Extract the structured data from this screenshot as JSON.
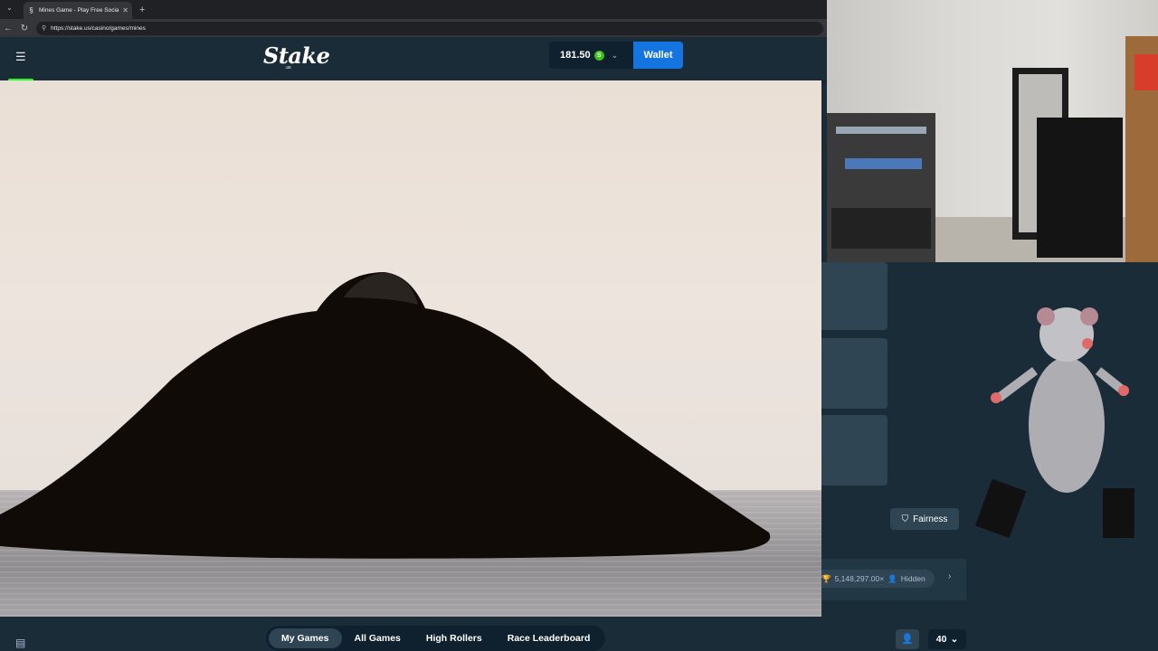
{
  "browser": {
    "tab_title": "Mines Game - Play Free Social Ca",
    "new_tab": "+",
    "url": "https://stake.us/casino/games/mines"
  },
  "header": {
    "logo_text": "Stake",
    "logo_sub": ".us",
    "balance": "181.50",
    "currency_symbol": "S",
    "wallet_label": "Wallet"
  },
  "right_panel": {
    "fairness_label": "Fairness",
    "stats": {
      "amount": "5,148,297.00×",
      "hidden_label": "Hidden"
    }
  },
  "bottom": {
    "tabs": [
      {
        "label": "My Games",
        "active": true
      },
      {
        "label": "All Games",
        "active": false
      },
      {
        "label": "High Rollers",
        "active": false
      },
      {
        "label": "Race Leaderboard",
        "active": false
      }
    ],
    "rows_value": "40"
  },
  "colors": {
    "bg": "#1a2c38",
    "accent_blue": "#1475e1",
    "accent_green": "#1fff20",
    "card": "#2f4553"
  }
}
